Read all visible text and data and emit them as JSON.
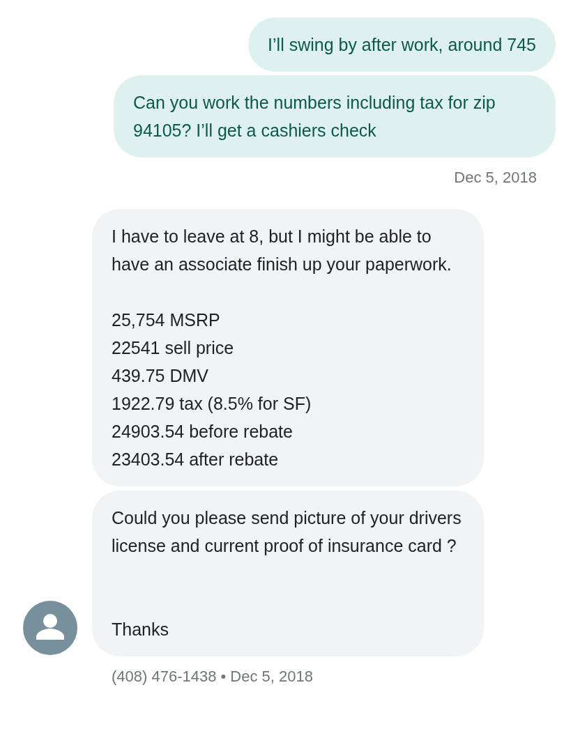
{
  "messages": [
    {
      "kind": "outgoing",
      "text": "I’ll swing by after work, around 745"
    },
    {
      "kind": "outgoing",
      "text": "Can you work the numbers including tax for zip 94105? I’ll get a cashiers check"
    },
    {
      "kind": "timestamp",
      "text": "Dec 5, 2018"
    },
    {
      "kind": "incoming",
      "text": "I have to leave at 8, but I might be able to have an associate finish up your paperwork.\n\n25,754 MSRP\n22541 sell price\n439.75 DMV\n1922.79 tax (8.5% for SF)\n24903.54 before rebate\n23403.54 after rebate"
    },
    {
      "kind": "incoming",
      "text": "Could you please send picture of your drivers license and current proof of insurance card ?\n\n\nThanks"
    }
  ],
  "sender_line": "(408) 476-1438 • Dec 5, 2018"
}
